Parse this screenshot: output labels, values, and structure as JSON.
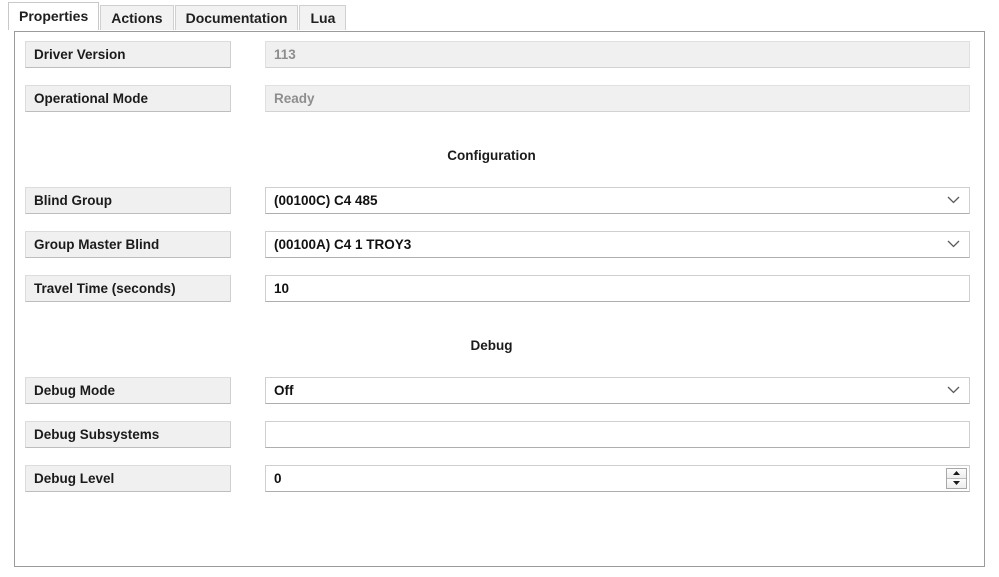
{
  "tabs": [
    {
      "label": "Properties",
      "selected": true
    },
    {
      "label": "Actions",
      "selected": false
    },
    {
      "label": "Documentation",
      "selected": false
    },
    {
      "label": "Lua",
      "selected": false
    }
  ],
  "sections": {
    "configuration": "Configuration",
    "debug": "Debug"
  },
  "fields": {
    "driver_version": {
      "label": "Driver Version",
      "value": "113",
      "type": "text",
      "disabled": true
    },
    "operational_mode": {
      "label": "Operational Mode",
      "value": "Ready",
      "type": "text",
      "disabled": true
    },
    "blind_group": {
      "label": "Blind Group",
      "value": "(00100C)  C4 485",
      "type": "combobox",
      "disabled": false
    },
    "group_master_blind": {
      "label": "Group Master Blind",
      "value": "(00100A)  C4 1 TROY3",
      "type": "combobox",
      "disabled": false
    },
    "travel_time": {
      "label": "Travel Time (seconds)",
      "value": "10",
      "type": "text",
      "disabled": false
    },
    "debug_mode": {
      "label": "Debug Mode",
      "value": "Off",
      "type": "combobox",
      "disabled": false
    },
    "debug_subsystems": {
      "label": "Debug Subsystems",
      "value": "",
      "type": "text",
      "disabled": false
    },
    "debug_level": {
      "label": "Debug Level",
      "value": "0",
      "type": "spinner",
      "disabled": false
    }
  },
  "colors": {
    "label_bg": "#f0f0f0",
    "disabled_text": "#8e8e8e",
    "text": "#111111",
    "panel_border": "#9b9b9b",
    "tab_selected_bg": "#ffffff",
    "tab_bg": "#f2f2f2"
  }
}
